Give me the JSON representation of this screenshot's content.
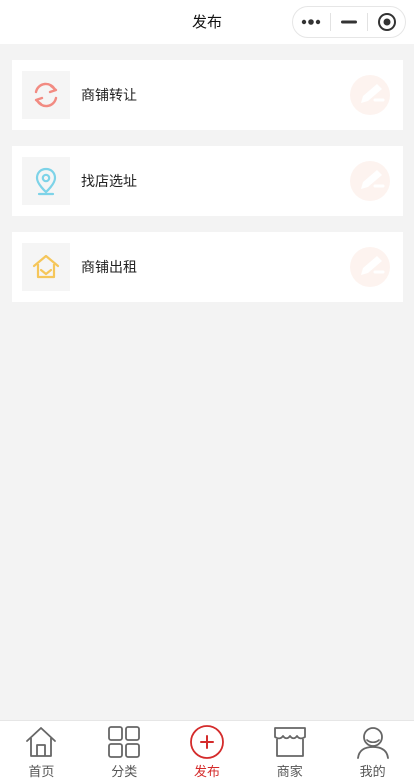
{
  "header": {
    "title": "发布"
  },
  "items": [
    {
      "label": "商铺转让",
      "icon": "refresh-icon",
      "color": "#f28b82"
    },
    {
      "label": "找店选址",
      "icon": "location-pin-icon",
      "color": "#7dd3e8"
    },
    {
      "label": "商铺出租",
      "icon": "house-icon",
      "color": "#f5c65a"
    }
  ],
  "tabs": [
    {
      "label": "首页",
      "icon": "home-icon"
    },
    {
      "label": "分类",
      "icon": "grid-icon"
    },
    {
      "label": "发布",
      "icon": "plus-circle-icon",
      "active": true
    },
    {
      "label": "商家",
      "icon": "shop-icon"
    },
    {
      "label": "我的",
      "icon": "user-icon"
    }
  ],
  "colors": {
    "accent": "#d42b2b",
    "background": "#f3f3f3"
  }
}
